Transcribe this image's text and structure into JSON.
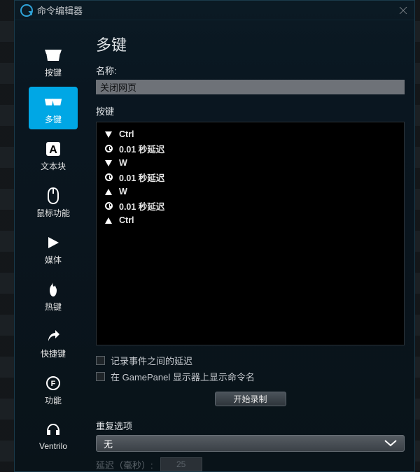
{
  "window": {
    "title": "命令编辑器"
  },
  "sidebar": {
    "items": [
      {
        "label": "按键"
      },
      {
        "label": "多键"
      },
      {
        "label": "文本块"
      },
      {
        "label": "鼠标功能"
      },
      {
        "label": "媒体"
      },
      {
        "label": "热键"
      },
      {
        "label": "快捷键"
      },
      {
        "label": "功能"
      },
      {
        "label": "Ventrilo"
      }
    ]
  },
  "main": {
    "section_title": "多键",
    "name_label": "名称:",
    "name_value": "关闭网页",
    "keys_label": "按键",
    "key_events": [
      {
        "icon": "down",
        "text": "Ctrl"
      },
      {
        "icon": "clock",
        "text": "0.01 秒延迟"
      },
      {
        "icon": "down",
        "text": "W"
      },
      {
        "icon": "clock",
        "text": "0.01 秒延迟"
      },
      {
        "icon": "up",
        "text": "W"
      },
      {
        "icon": "clock",
        "text": "0.01 秒延迟"
      },
      {
        "icon": "up",
        "text": "Ctrl"
      }
    ],
    "checkbox1_label": "记录事件之间的延迟",
    "checkbox2_label": "在 GamePanel 显示器上显示命令名",
    "record_button": "开始录制",
    "repeat_label": "重复选项",
    "repeat_value": "无",
    "delay_label": "延迟（毫秒）:",
    "delay_value": "25"
  }
}
